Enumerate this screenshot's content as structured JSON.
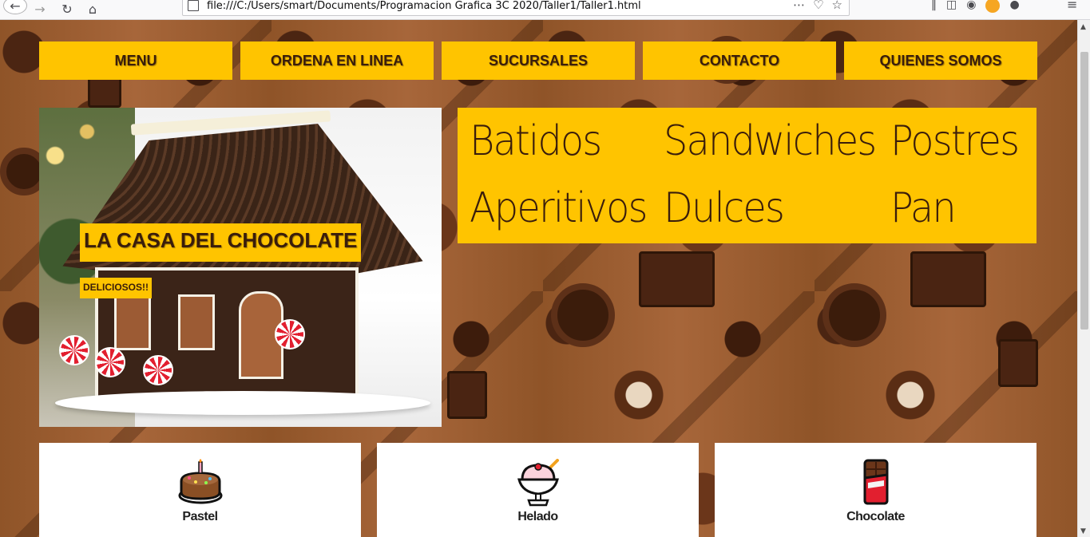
{
  "browser": {
    "url": "file:///C:/Users/smart/Documents/Programacion Grafica 3C 2020/Taller1/Taller1.html",
    "icons": [
      "back-icon",
      "forward-icon",
      "reload-icon",
      "home-icon",
      "page-icon",
      "more-icon",
      "pocket-icon",
      "bookmark-star-icon",
      "library-icon",
      "sidebar-icon",
      "account-icon",
      "extension-icon",
      "extension2-icon",
      "menu-icon"
    ]
  },
  "nav": {
    "items": [
      "MENU",
      "ORDENA EN LINEA",
      "SUCURSALES",
      "CONTACTO",
      "QUIENES SOMOS"
    ]
  },
  "hero": {
    "title": "LA CASA DEL CHOCOLATE",
    "subtitle": "DELICIOSOS!!"
  },
  "categories": {
    "items": [
      "Batidos",
      "Sandwiches",
      "Postres",
      "Aperitivos",
      "Dulces",
      "Pan"
    ]
  },
  "products": [
    {
      "label": "Pastel",
      "icon": "cake-icon"
    },
    {
      "label": "Helado",
      "icon": "ice-cream-icon"
    },
    {
      "label": "Chocolate",
      "icon": "chocolate-bar-icon"
    }
  ],
  "colors": {
    "accent": "#ffc400",
    "text_dark": "#3a1d0b",
    "background": "#8a4f24"
  }
}
